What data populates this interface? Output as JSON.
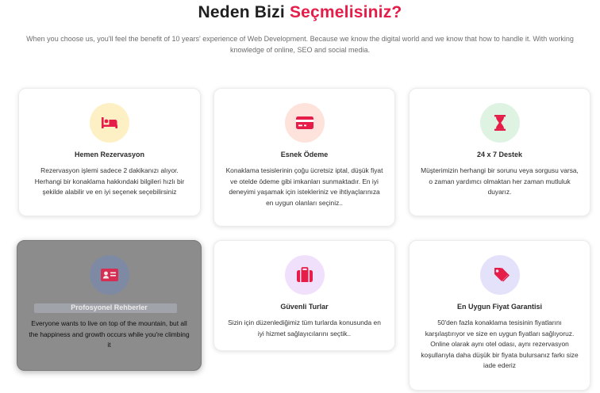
{
  "section": {
    "title_main": "Neden Bizi",
    "title_accent": "Seçmelisiniz?",
    "subtitle": "When you choose us, you'll feel the benefit of 10 years' experience of Web Development. Because we know the digital world and we know that how to handle it. With working knowledge of online, SEO and social media."
  },
  "colors": {
    "accent": "#e51d48",
    "icon_bg_yellow": "#fdf0c4",
    "icon_bg_peach": "#fde3dc",
    "icon_bg_mint": "#dff3e3",
    "icon_bg_blue": "#dde2f7",
    "icon_bg_lilac": "#f1e0fb",
    "icon_bg_lavender": "#e4e1fa"
  },
  "cards": [
    {
      "icon": "bed-icon",
      "title": "Hemen Rezervasyon",
      "text": "Rezervasyon işlemi sadece 2 dakikanızı alıyor. Herhangi bir konaklama hakkındaki bilgileri hızlı bir şekilde alabilir ve en iyi seçenek seçebilirsiniz"
    },
    {
      "icon": "credit-card-icon",
      "title": "Esnek Ödeme",
      "text": "Konaklama tesislerinin çoğu ücretsiz iptal, düşük fiyat ve otelde ödeme gibi imkanları sunmaktadır. En iyi deneyimi yaşamak için istekleriniz ve ihtiyaçlarınıza en uygun olanları seçiniz.."
    },
    {
      "icon": "hourglass-icon",
      "title": "24 x 7 Destek",
      "text": "Müşterimizin herhangi bir sorunu veya sorgusu varsa, o zaman yardımcı olmaktan her zaman mutluluk duyarız."
    },
    {
      "icon": "id-card-icon",
      "title": "Profosyonel Rehberler",
      "text": "Everyone wants to live on top of the mountain, but all the happiness and growth occurs while you're climbing it"
    },
    {
      "icon": "suitcase-icon",
      "title": "Güvenli Turlar",
      "text": "Sizin için düzenlediğimiz tüm turlarda konusunda en iyi hizmet sağlayıcılarını seçtik.."
    },
    {
      "icon": "price-tag-icon",
      "title": "En Uygun Fiyat Garantisi",
      "text": "50'den fazla konaklama tesisinin fiyatlarını karşılaştırıyor ve size en uygun fiyatları sağlıyoruz. Online olarak aynı otel odası, aynı rezervasyon koşullarıyla daha düşük bir fiyata bulursanız farkı size iade ederiz"
    }
  ]
}
